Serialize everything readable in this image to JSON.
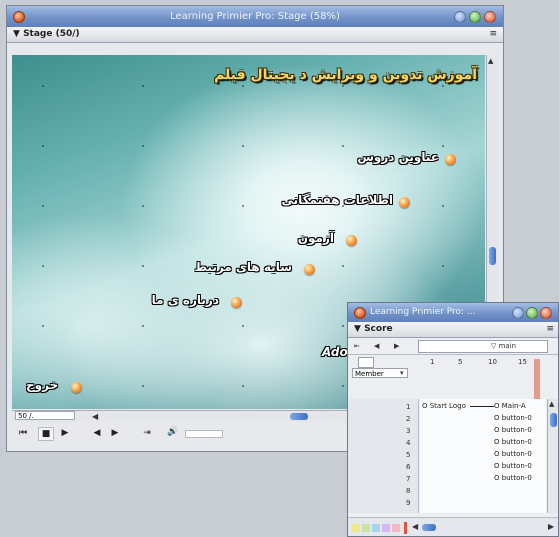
{
  "stage_window": {
    "title": "Learning Primier Pro: Stage (58%)",
    "panel_label": "Stage (50/)",
    "zoom_field": "50 /.",
    "canvas": {
      "heading": "آموزش تدوین و ویرایش د یجیتال فیلم",
      "menu_items": [
        "عناوین دروس",
        "اطلاعات هفتمگانی",
        "آزمون",
        "سایه های مرتبط",
        "درباره ی ما"
      ],
      "exit_label": "خروج",
      "partial_logo": "Adob"
    },
    "playback": {
      "rewind": "⏮",
      "stop": "■",
      "play": "▶",
      "step_back": "◀",
      "step_fwd": "▶",
      "loop": "⇥",
      "volume": "🔊"
    }
  },
  "score_window": {
    "title": "Learning Primier Pro: ...",
    "panel_label": "Score",
    "marker_label": "▽ main",
    "header_numbers": [
      "1",
      "5",
      "10",
      "15"
    ],
    "member_dropdown": "Member",
    "channel_numbers": [
      "1",
      "2",
      "3",
      "4",
      "5",
      "6",
      "7",
      "8",
      "9"
    ],
    "sprites": [
      "O Start Logo",
      "O Main-A",
      "O button-0",
      "O button-0",
      "O button-0",
      "O button-0",
      "O button-0",
      "O button-0"
    ]
  },
  "colors": {
    "titlebar": "#6f8fc6",
    "accent_bullet": "#f8a44a",
    "heading_text": "#f2d66a",
    "playhead": "#e0553a"
  }
}
